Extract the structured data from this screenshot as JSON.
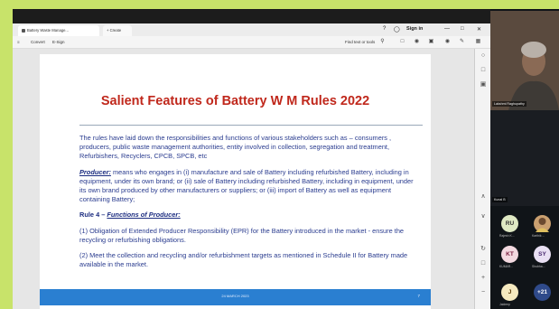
{
  "browser": {
    "tab_title": "Battery Waste Manage...",
    "new_tab_label": "+ Create",
    "sign_in": "Sign in",
    "win_controls": [
      "—",
      "□",
      "✕"
    ]
  },
  "toolbar": {
    "convert": "Convert",
    "esign": "E-Sign",
    "find": "Find text or tools"
  },
  "slide": {
    "title": "Salient Features of Battery W M Rules 2022",
    "intro": "The rules have laid down the responsibilities and functions of various stakeholders such as – consumers , producers, public waste management authorities, entity involved in collection, segregation and treatment, Refurbishers, Recyclers, CPCB, SPCB, etc",
    "producer_term": "Producer:",
    "producer_def": " means who engages in (i) manufacture and sale of Battery including refurbished Battery, including in equipment, under its own brand; or (ii) sale of Battery including refurbished Battery, including in equipment, under its own brand produced by other manufacturers or suppliers; or (iii) import of Battery as well as equipment containing Battery;",
    "rule4_prefix": "Rule 4 – ",
    "rule4_sub": "Functions of Producer:",
    "item1": "(1)  Obligation of Extended Producer Responsibility (EPR) for the Battery introduced in the market - ensure the recycling or refurbishing obligations.",
    "item2": "(2) Meet the collection and recycling and/or refurbishment targets as mentioned in Schedule II for Battery made available in the market.",
    "footer_center": "24 MARCH 2023",
    "footer_page": "7"
  },
  "participants": {
    "speaker_name": "Lakshmi Raghupathy",
    "second_name": "Kunal B",
    "avatars": [
      {
        "initials": "RU",
        "label": "Rajesh K...",
        "color": "#dfe9c4",
        "text": "#333333"
      },
      {
        "initials": "",
        "label": "Karthik ...",
        "color": "#caa070",
        "text": "#333333"
      },
      {
        "initials": "KT",
        "label": "KUMAR...",
        "color": "#f3d9e0",
        "text": "#7a2040"
      },
      {
        "initials": "SY",
        "label": "Shubha...",
        "color": "#e9e0f3",
        "text": "#4a2a70"
      },
      {
        "initials": "J",
        "label": "Jaideep",
        "color": "#f5eac0",
        "text": "#553300"
      },
      {
        "initials": "+21",
        "label": "",
        "color": "#2f4a8a",
        "text": "#ffffff"
      }
    ]
  }
}
